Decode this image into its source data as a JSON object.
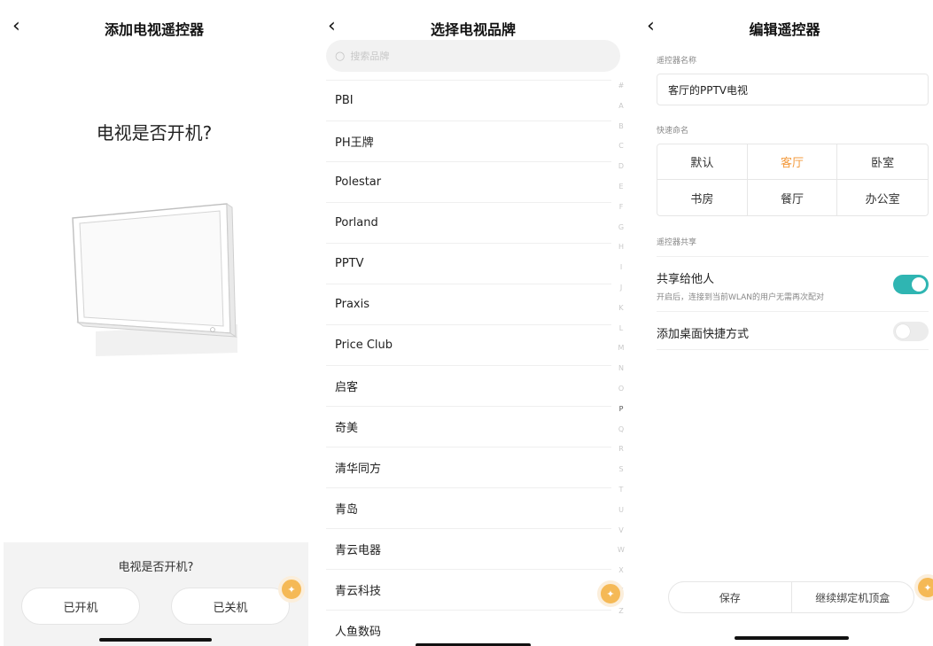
{
  "screen1": {
    "title": "添加电视遥控器",
    "question": "电视是否开机?",
    "panel_question": "电视是否开机?",
    "on_button": "已开机",
    "off_button": "已关机"
  },
  "screen2": {
    "title": "选择电视品牌",
    "search_placeholder": "搜索品牌",
    "brands": [
      "PBI",
      "PH王牌",
      "Polestar",
      "Porland",
      "PPTV",
      "Praxis",
      "Price Club",
      "启客",
      "奇美",
      "清华同方",
      "青岛",
      "青云电器",
      "青云科技",
      "人鱼数码"
    ],
    "index_letters": [
      "#",
      "A",
      "B",
      "C",
      "D",
      "E",
      "F",
      "G",
      "H",
      "I",
      "J",
      "K",
      "L",
      "M",
      "N",
      "O",
      "P",
      "Q",
      "R",
      "S",
      "T",
      "U",
      "V",
      "W",
      "X",
      "Y",
      "Z"
    ],
    "active_index": "P"
  },
  "screen3": {
    "title": "编辑遥控器",
    "name_label": "遥控器名称",
    "name_value": "客厅的PPTV电视",
    "quick_label": "快速命名",
    "quick_names": [
      "默认",
      "客厅",
      "卧室",
      "书房",
      "餐厅",
      "办公室"
    ],
    "selected_quick_name": "客厅",
    "share_label": "遥控器共享",
    "share_title": "共享给他人",
    "share_desc": "开启后，连接到当前WLAN的用户无需再次配对",
    "share_on": true,
    "shortcut_title": "添加桌面快捷方式",
    "shortcut_on": false,
    "save_button": "保存",
    "continue_button": "继续绑定机顶盒"
  },
  "colors": {
    "accent_orange": "#f39a3d",
    "toggle_on": "#2fb5b2",
    "float_button": "#f5b956"
  }
}
